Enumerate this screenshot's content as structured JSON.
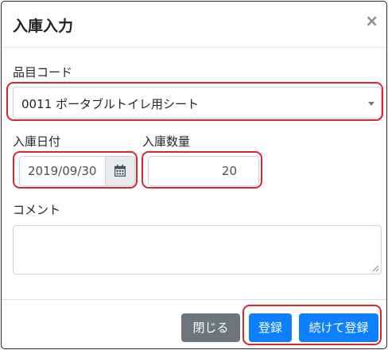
{
  "modal": {
    "title": "入庫入力",
    "close_symbol": "×"
  },
  "form": {
    "item_code": {
      "label": "品目コード",
      "value": "0011 ポータブルトイレ用シート"
    },
    "arrival_date": {
      "label": "入庫日付",
      "value": "2019/09/30"
    },
    "arrival_qty": {
      "label": "入庫数量",
      "value": "20"
    },
    "comment": {
      "label": "コメント",
      "value": ""
    }
  },
  "footer": {
    "close_label": "閉じる",
    "register_label": "登録",
    "continue_register_label": "続けて登録"
  },
  "colors": {
    "primary": "#0d7fff",
    "secondary": "#6c757d",
    "highlight": "#e0242b"
  },
  "icons": {
    "date_addon": "calendar-icon",
    "select_caret": "caret-down-icon",
    "close": "close-icon"
  }
}
